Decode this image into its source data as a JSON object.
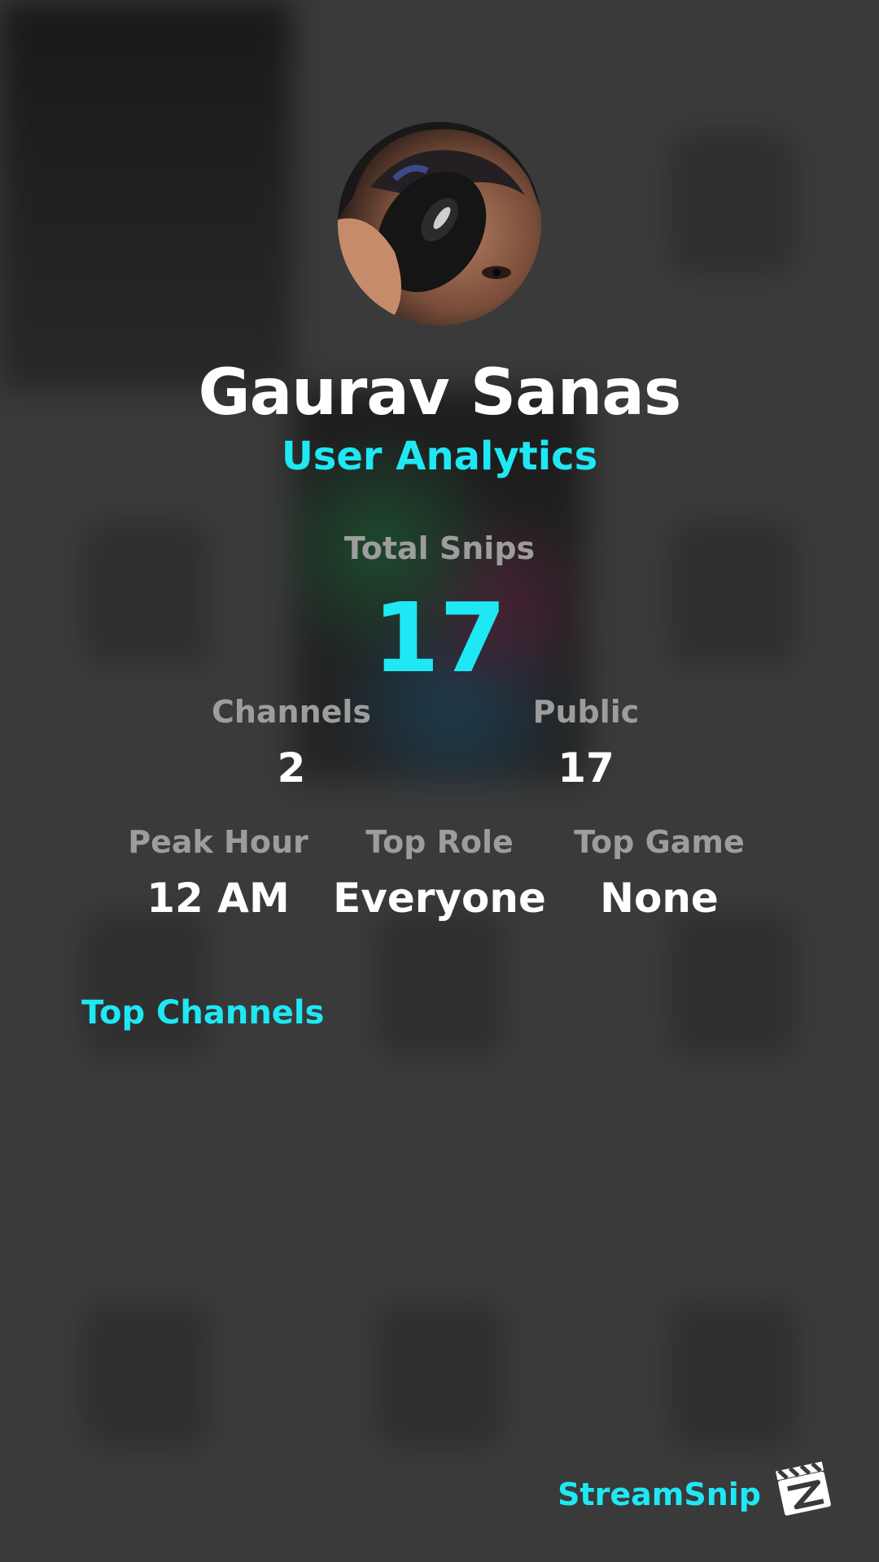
{
  "profile": {
    "name": "Gaurav Sanas",
    "subtitle": "User Analytics"
  },
  "stats": {
    "total_label": "Total Snips",
    "total_value": "17",
    "channels_label": "Channels",
    "channels_value": "2",
    "public_label": "Public",
    "public_value": "17",
    "peak_hour_label": "Peak Hour",
    "peak_hour_value": "12 AM",
    "top_role_label": "Top Role",
    "top_role_value": "Everyone",
    "top_game_label": "Top Game",
    "top_game_value": "None"
  },
  "sections": {
    "top_channels": "Top Channels"
  },
  "brand": {
    "name": "StreamSnip",
    "icon": "clapperboard-icon"
  },
  "colors": {
    "accent": "#1fe8f5",
    "background": "#3a3a3a",
    "label": "#9d9d9d",
    "text": "#ffffff"
  }
}
